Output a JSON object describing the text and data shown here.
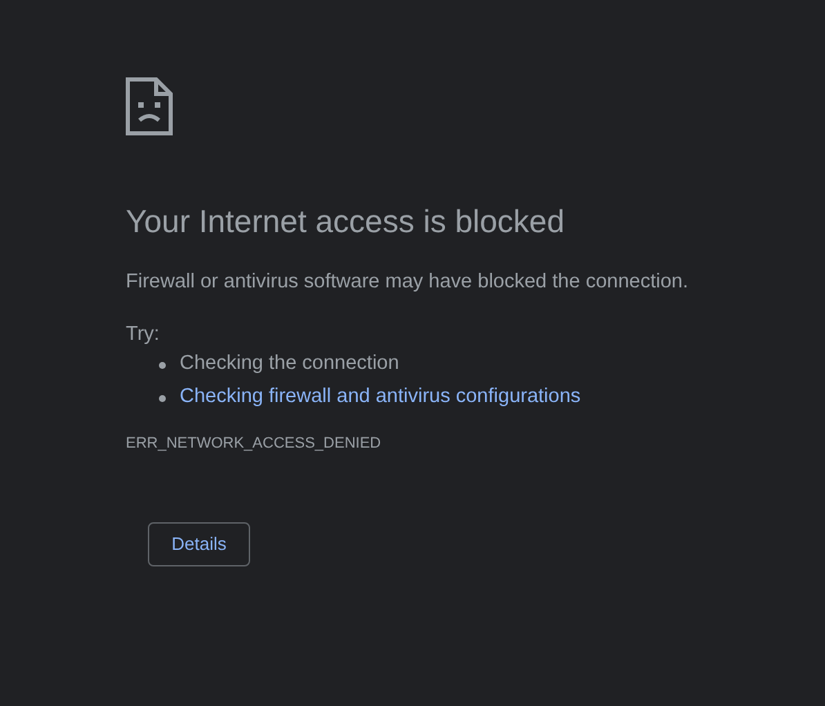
{
  "heading": "Your Internet access is blocked",
  "message": "Firewall or antivirus software may have blocked the connection.",
  "try_label": "Try:",
  "suggestions": [
    {
      "kind": "text",
      "text": "Checking the connection"
    },
    {
      "kind": "link",
      "text": "Checking firewall and antivirus configurations"
    }
  ],
  "error_code": "ERR_NETWORK_ACCESS_DENIED",
  "details_button": "Details"
}
